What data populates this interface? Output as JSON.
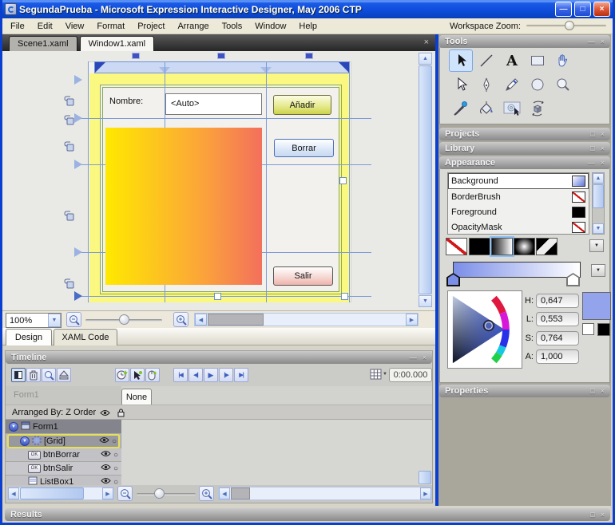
{
  "window": {
    "title": "SegundaPrueba - Microsoft Expression Interactive Designer, May 2006 CTP"
  },
  "icons": {
    "minimize": "—",
    "maximize": "□",
    "close": "×",
    "panel_min": "—",
    "panel_restore": "□",
    "panel_close": "×",
    "dropdown": "▼",
    "up": "▲",
    "down": "▼",
    "left": "◀",
    "right": "▶",
    "circle": "○",
    "button_glyph": "OK",
    "zoom_in": "+",
    "zoom_out": "−"
  },
  "menubar": {
    "items": [
      "File",
      "Edit",
      "View",
      "Format",
      "Project",
      "Arrange",
      "Tools",
      "Window",
      "Help"
    ],
    "workspace_zoom_label": "Workspace Zoom:"
  },
  "doc_tabs": {
    "tabs": [
      "Scene1.xaml",
      "Window1.xaml"
    ],
    "active": "Window1.xaml"
  },
  "artboard": {
    "name_label": "Nombre:",
    "name_value": "<Auto>",
    "add_button": "Añadir",
    "delete_button": "Borrar",
    "exit_button": "Salir",
    "rect_gradient_start": "#ffe900",
    "rect_gradient_end": "#f3705c"
  },
  "zoom_bar": {
    "zoom_value": "100%"
  },
  "view_tabs": {
    "design": "Design",
    "xaml": "XAML Code"
  },
  "tools_panel": {
    "title": "Tools",
    "text_tool_glyph": "A",
    "items": [
      "selection",
      "line",
      "text",
      "rectangle",
      "pan",
      "direct-selection",
      "pen",
      "pencil",
      "ellipse",
      "zoom",
      "eyedropper",
      "paint-bucket",
      "brush-transform",
      "camera-orbit"
    ],
    "selected_tool": "selection"
  },
  "projects_panel": {
    "title": "Projects"
  },
  "library_panel": {
    "title": "Library"
  },
  "appearance_panel": {
    "title": "Appearance",
    "rows": [
      {
        "name": "Background",
        "swatch": "linear-gradient-blue",
        "selected": true
      },
      {
        "name": "BorderBrush",
        "swatch": "null"
      },
      {
        "name": "Foreground",
        "swatch": "solid-black"
      },
      {
        "name": "OpacityMask",
        "swatch": "null"
      }
    ],
    "brush_types": [
      "null",
      "solid",
      "linear-gradient",
      "radial-gradient",
      "tile"
    ],
    "selected_brush": "linear-gradient",
    "gradient": {
      "start_color": "#7b8ee8",
      "end_color": "#ffffff"
    },
    "color": {
      "h_label": "H:",
      "h_value": "0,647",
      "l_label": "L:",
      "l_value": "0,553",
      "s_label": "S:",
      "s_value": "0,764",
      "a_label": "A:",
      "a_value": "1,000",
      "current_hex": "#93a3ec"
    }
  },
  "properties_panel": {
    "title": "Properties"
  },
  "timeline": {
    "title": "Timeline",
    "time": "0:00.000",
    "scene_label": "Form1",
    "animation_tab": "None",
    "arranged_by": "Arranged By: Z Order",
    "transport": [
      "|◀",
      "◀|",
      "▶",
      "|▶",
      "▶|"
    ],
    "tree": [
      {
        "label": "Form1",
        "icon": "window-icon"
      },
      {
        "label": "[Grid]",
        "icon": "grid-icon",
        "selected": true
      },
      {
        "label": "btnBorrar",
        "icon": "button-icon"
      },
      {
        "label": "btnSalir",
        "icon": "button-icon"
      },
      {
        "label": "ListBox1",
        "icon": "listbox-icon"
      }
    ]
  },
  "results_panel": {
    "title": "Results"
  }
}
